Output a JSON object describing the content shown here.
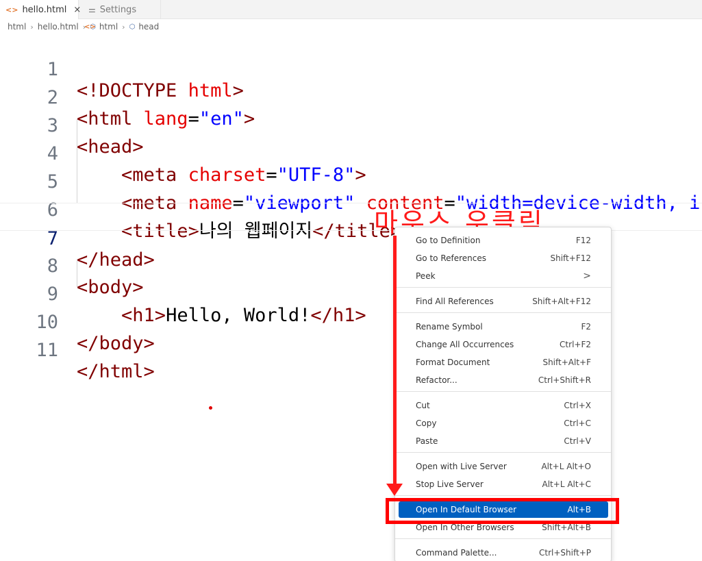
{
  "tabs": [
    {
      "icon": "<>",
      "label": "hello.html",
      "close": "×"
    },
    {
      "icon": "⚌",
      "label": "Settings"
    }
  ],
  "breadcrumb": [
    "html",
    "hello.html",
    "html",
    "head"
  ],
  "editor": {
    "lines": [
      {
        "n": "1"
      },
      {
        "n": "2"
      },
      {
        "n": "3"
      },
      {
        "n": "4"
      },
      {
        "n": "5"
      },
      {
        "n": "6"
      },
      {
        "n": "7"
      },
      {
        "n": "8"
      },
      {
        "n": "9"
      },
      {
        "n": "10"
      },
      {
        "n": "11"
      }
    ],
    "code": {
      "l1": {
        "a": "<!DOCTYPE",
        "b": " html",
        "c": ">"
      },
      "l2": {
        "a": "<html",
        "b": " lang",
        "c": "=",
        "d": "\"en\"",
        "e": ">"
      },
      "l3": {
        "a": "<head>"
      },
      "l4": {
        "a": "<meta",
        "b": " charset",
        "c": "=",
        "d": "\"UTF-8\"",
        "e": ">"
      },
      "l5": {
        "a": "<meta",
        "b": " name",
        "c": "=",
        "d": "\"viewport\"",
        "e": " content",
        "f": "=",
        "g": "\"width=device-width, i"
      },
      "l6": {
        "a": "<title>",
        "b": "나의 웹페이지",
        "c": "</title>"
      },
      "l7": {
        "a": "</head>"
      },
      "l8": {
        "a": "<body>"
      },
      "l9": {
        "a": "<h1>",
        "b": "Hello, World!",
        "c": "</h1>"
      },
      "l10": {
        "a": "</body>"
      },
      "l11": {
        "a": "</html>"
      }
    }
  },
  "annotation": {
    "label": "마우스 우클릭",
    "color": "#ff1a1a"
  },
  "context_menu": {
    "groups": [
      [
        {
          "label": "Go to Definition",
          "key": "F12"
        },
        {
          "label": "Go to References",
          "key": "Shift+F12"
        },
        {
          "label": "Peek",
          "key": ">"
        }
      ],
      [
        {
          "label": "Find All References",
          "key": "Shift+Alt+F12"
        }
      ],
      [
        {
          "label": "Rename Symbol",
          "key": "F2"
        },
        {
          "label": "Change All Occurrences",
          "key": "Ctrl+F2"
        },
        {
          "label": "Format Document",
          "key": "Shift+Alt+F"
        },
        {
          "label": "Refactor...",
          "key": "Ctrl+Shift+R"
        }
      ],
      [
        {
          "label": "Cut",
          "key": "Ctrl+X"
        },
        {
          "label": "Copy",
          "key": "Ctrl+C"
        },
        {
          "label": "Paste",
          "key": "Ctrl+V"
        }
      ],
      [
        {
          "label": "Open with Live Server",
          "key": "Alt+L Alt+O"
        },
        {
          "label": "Stop Live Server",
          "key": "Alt+L Alt+C"
        }
      ],
      [
        {
          "label": "Open In Default Browser",
          "key": "Alt+B"
        },
        {
          "label": "Open In Other Browsers",
          "key": "Shift+Alt+B"
        }
      ],
      [
        {
          "label": "Command Palette...",
          "key": "Ctrl+Shift+P"
        }
      ]
    ],
    "selected": "Open In Default Browser",
    "selected_color": "#0060c0"
  }
}
